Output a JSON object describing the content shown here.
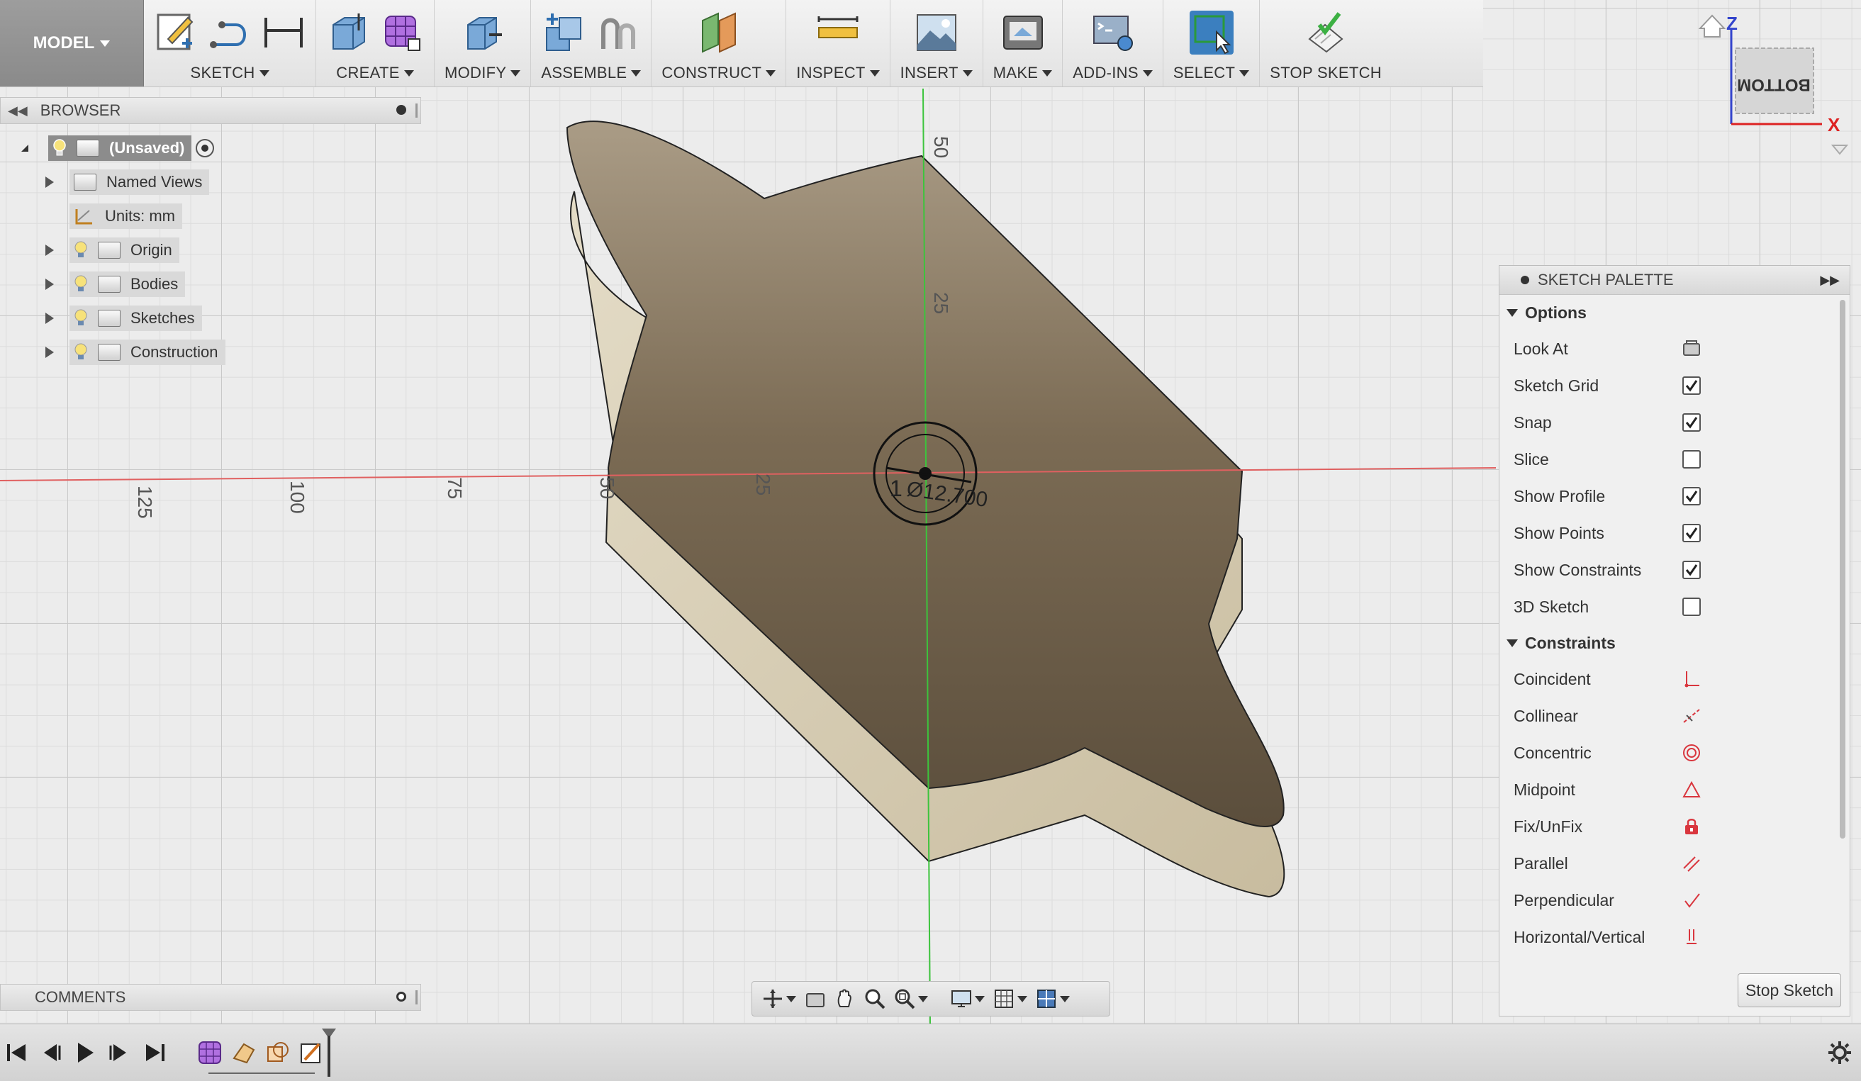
{
  "toolbar": {
    "workspace": "MODEL",
    "groups": [
      {
        "label": "SKETCH"
      },
      {
        "label": "CREATE"
      },
      {
        "label": "MODIFY"
      },
      {
        "label": "ASSEMBLE"
      },
      {
        "label": "CONSTRUCT"
      },
      {
        "label": "INSPECT"
      },
      {
        "label": "INSERT"
      },
      {
        "label": "MAKE"
      },
      {
        "label": "ADD-INS"
      },
      {
        "label": "SELECT"
      },
      {
        "label": "STOP SKETCH"
      }
    ]
  },
  "browser": {
    "title": "BROWSER",
    "root": "(Unsaved)",
    "items": [
      {
        "label": "Named Views"
      },
      {
        "label": "Units: mm"
      },
      {
        "label": "Origin"
      },
      {
        "label": "Bodies"
      },
      {
        "label": "Sketches"
      },
      {
        "label": "Construction"
      }
    ]
  },
  "comments": {
    "title": "COMMENTS"
  },
  "viewport": {
    "ruler_labels_x": [
      "125",
      "100",
      "75",
      "50",
      "25"
    ],
    "ruler_labels_y": [
      "50",
      "25"
    ],
    "dimension": "Ø12.700",
    "dimension_prefix": "1"
  },
  "viewcube": {
    "face": "BOTTOM",
    "axis_z": "Z",
    "axis_x": "X"
  },
  "palette": {
    "title": "SKETCH PALETTE",
    "options_title": "Options",
    "options": [
      {
        "label": "Look At",
        "type": "button"
      },
      {
        "label": "Sketch Grid",
        "checked": true
      },
      {
        "label": "Snap",
        "checked": true
      },
      {
        "label": "Slice",
        "checked": false
      },
      {
        "label": "Show Profile",
        "checked": true
      },
      {
        "label": "Show Points",
        "checked": true
      },
      {
        "label": "Show Constraints",
        "checked": true
      },
      {
        "label": "3D Sketch",
        "checked": false
      }
    ],
    "constraints_title": "Constraints",
    "constraints": [
      {
        "label": "Coincident",
        "icon": "coincident-icon"
      },
      {
        "label": "Collinear",
        "icon": "collinear-icon"
      },
      {
        "label": "Concentric",
        "icon": "concentric-icon"
      },
      {
        "label": "Midpoint",
        "icon": "midpoint-icon"
      },
      {
        "label": "Fix/UnFix",
        "icon": "lock-icon"
      },
      {
        "label": "Parallel",
        "icon": "parallel-icon"
      },
      {
        "label": "Perpendicular",
        "icon": "perpendicular-icon"
      },
      {
        "label": "Horizontal/Vertical",
        "icon": "horizontal-vertical-icon"
      }
    ],
    "stop_button": "Stop Sketch"
  },
  "colors": {
    "accent_select": "#3b7fbf",
    "body_top": "#6f6049",
    "body_side": "#d8cdb4",
    "axis_x": "#e06060",
    "axis_y": "#3cc43c",
    "constraint_red": "#d9363e"
  }
}
